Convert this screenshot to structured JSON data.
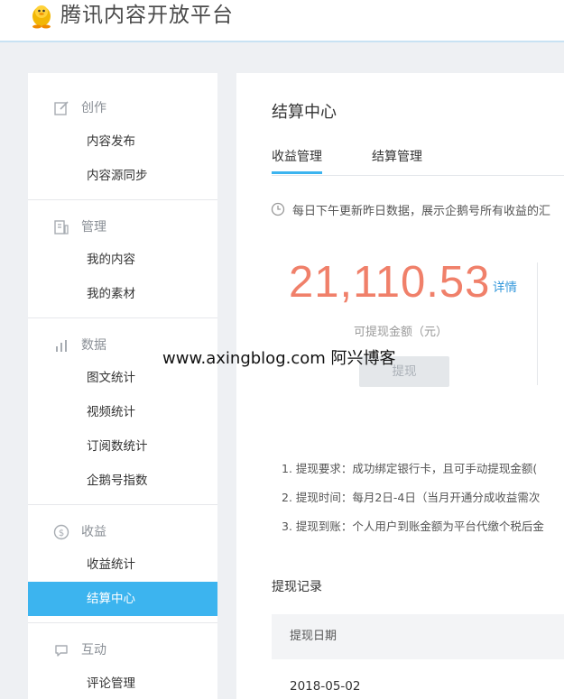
{
  "header": {
    "brand": "腾讯内容开放平台",
    "logo_icon": "penguin-logo-icon"
  },
  "sidebar": {
    "sections": [
      {
        "title": "创作",
        "icon": "edit-icon",
        "items": [
          "内容发布",
          "内容源同步"
        ]
      },
      {
        "title": "管理",
        "icon": "document-icon",
        "items": [
          "我的内容",
          "我的素材"
        ]
      },
      {
        "title": "数据",
        "icon": "bar-chart-icon",
        "items": [
          "图文统计",
          "视频统计",
          "订阅数统计",
          "企鹅号指数"
        ]
      },
      {
        "title": "收益",
        "icon": "dollar-coin-icon",
        "items": [
          "收益统计",
          "结算中心"
        ]
      },
      {
        "title": "互动",
        "icon": "chat-bubble-icon",
        "items": [
          "评论管理"
        ]
      }
    ],
    "active_item": "结算中心"
  },
  "main": {
    "title": "结算中心",
    "tabs": [
      {
        "label": "收益管理",
        "active": true
      },
      {
        "label": "结算管理",
        "active": false
      }
    ],
    "notice": "每日下午更新昨日数据，展示企鹅号所有收益的汇",
    "amount": "21,110.53",
    "detail_link": "详情",
    "amount_label": "可提现金额（元）",
    "withdraw_button": "提现",
    "rules": [
      "1. 提现要求：成功绑定银行卡，且可手动提现金额(",
      "2. 提现时间：每月2日-4日（当月开通分成收益需次",
      "3. 提现到账：个人用户到账金额为平台代缴个税后金"
    ],
    "records": {
      "title": "提现记录",
      "column_header": "提现日期",
      "rows": [
        "2018-05-02"
      ]
    }
  },
  "watermark": "www.axingblog.com 阿兴博客",
  "colors": {
    "accent": "#3cb4ef",
    "amount": "#f0806a",
    "link": "#3498db"
  }
}
